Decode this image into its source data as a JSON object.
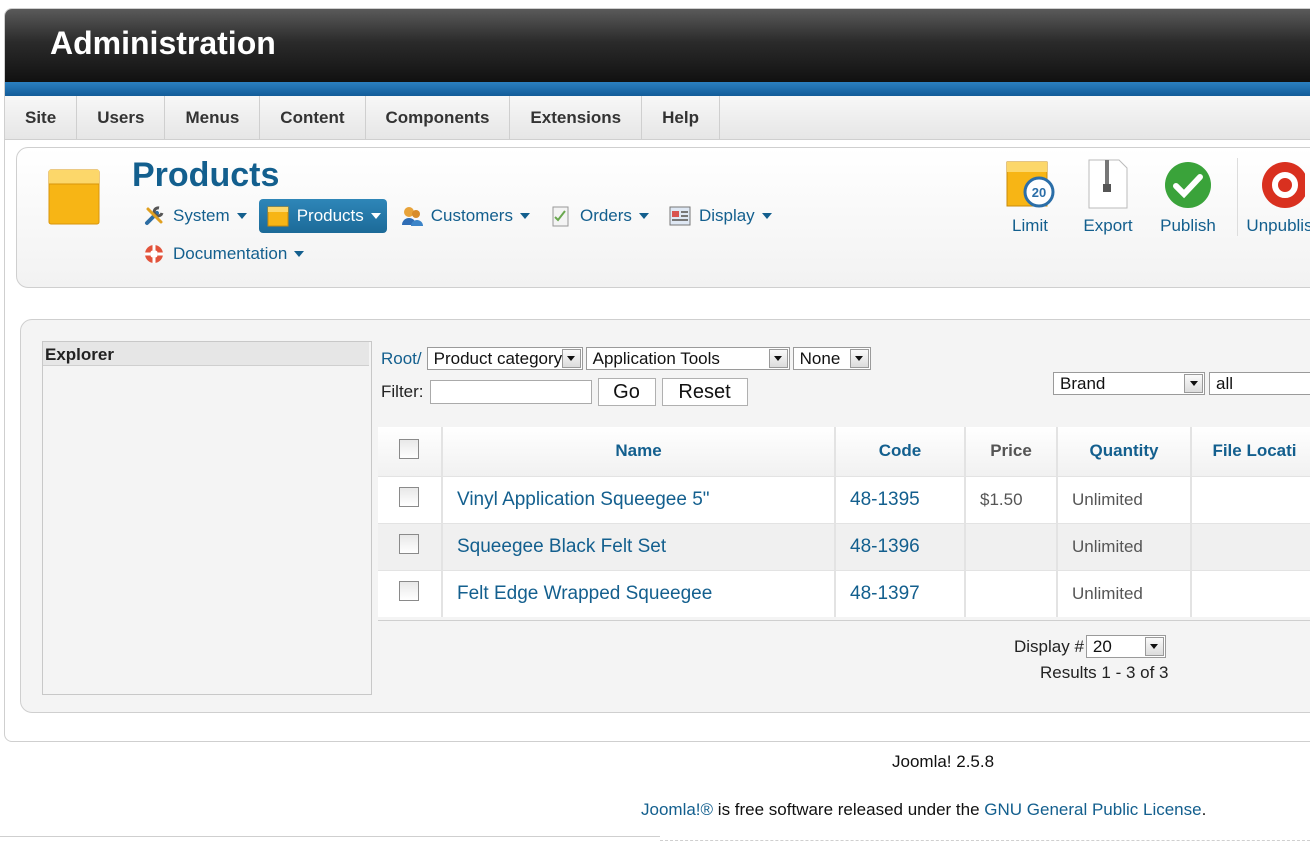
{
  "header": {
    "title": "Administration"
  },
  "menu": [
    "Site",
    "Users",
    "Menus",
    "Content",
    "Components",
    "Extensions",
    "Help"
  ],
  "page": {
    "title": "Products"
  },
  "submenu": [
    {
      "label": "System",
      "icon": "tools-icon"
    },
    {
      "label": "Products",
      "icon": "box-icon",
      "active": true
    },
    {
      "label": "Customers",
      "icon": "users-icon"
    },
    {
      "label": "Orders",
      "icon": "orders-icon"
    },
    {
      "label": "Display",
      "icon": "display-icon"
    },
    {
      "label": "Documentation",
      "icon": "lifebuoy-icon"
    }
  ],
  "toolbar": {
    "limit": "Limit",
    "export": "Export",
    "publish": "Publish",
    "unpublish": "Unpublis"
  },
  "explorer": {
    "title": "Explorer"
  },
  "crumbs": {
    "root": "Root/",
    "category_select": "Product category",
    "subcategory_select": "Application Tools",
    "none_select": "None"
  },
  "filter": {
    "label": "Filter:",
    "value": "",
    "go": "Go",
    "reset": "Reset"
  },
  "brand_filter": {
    "field": "Brand",
    "value": "all"
  },
  "table": {
    "columns": [
      "Name",
      "Code",
      "Price",
      "Quantity",
      "File Locati"
    ],
    "rows": [
      {
        "name": "Vinyl Application Squeegee 5\"",
        "code": "48-1395",
        "price": "$1.50",
        "quantity": "Unlimited",
        "file": ""
      },
      {
        "name": "Squeegee Black Felt Set",
        "code": "48-1396",
        "price": "",
        "quantity": "Unlimited",
        "file": ""
      },
      {
        "name": "Felt Edge Wrapped Squeegee",
        "code": "48-1397",
        "price": "",
        "quantity": "Unlimited",
        "file": ""
      }
    ]
  },
  "pager": {
    "display_label": "Display #",
    "display_value": "20",
    "results": "Results 1 - 3 of 3"
  },
  "footer": {
    "version": "Joomla! 2.5.8",
    "license_prefix": "Joomla!®",
    "license_middle": " is free software released under the ",
    "license_link": "GNU General Public License",
    "license_suffix": "."
  },
  "colors": {
    "link": "#135f8e",
    "header_dark": "#111111",
    "accent_blue": "#2b7fc0"
  }
}
